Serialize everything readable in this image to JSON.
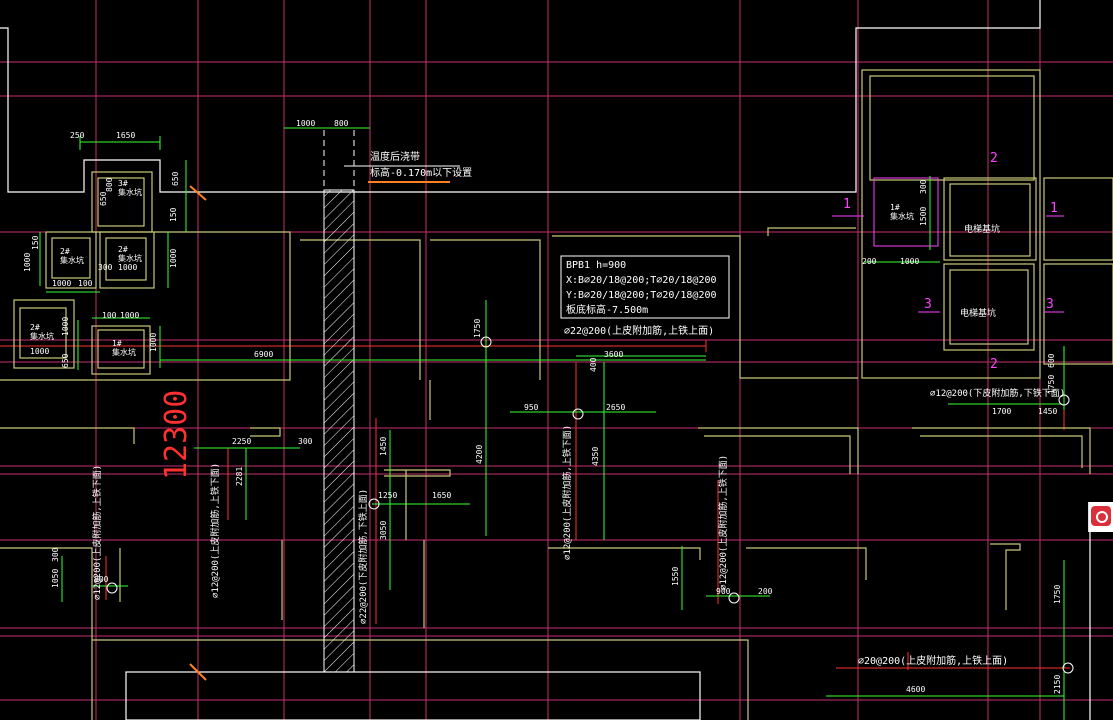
{
  "colors": {
    "background": "#000000",
    "axis": "#d0408c",
    "wall": "#c8c878",
    "rebar_red": "#ff3030",
    "dimension": "#33ff33",
    "outline": "#ffffff",
    "label": "#ffffff",
    "magenta": "#ff40ff",
    "orange": "#ff8020"
  },
  "notes": {
    "steel_title": "温度后浇带",
    "steel_level": "标高-0.170m以下设置",
    "big_dim": "12300"
  },
  "bpb": {
    "title": "BPB1 h=900",
    "xb": "X:B⌀20/18@200;T⌀20/18@200",
    "yb": "Y:B⌀20/18@200;T⌀20/18@200",
    "level": "板底标高-7.500m"
  },
  "pits": {
    "p1": "1#\n集水坑",
    "p2": "2#\n集水坑",
    "p3": "2#\n集水坑",
    "p4": "3#\n集水坑",
    "p5": "2#\n集水坑",
    "p6": "1#\n集水坑",
    "elevator1": "电梯基坑",
    "elevator2": "电梯基坑"
  },
  "rebar": {
    "r1": "⌀22@200(上皮附加筋,上铁上面)",
    "r2": "⌀12@200(下皮附加筋,下铁下面)",
    "r3": "⌀20@200(上皮附加筋,上铁上面)",
    "v1": "⌀12@200(上皮附加筋,上铁下面)",
    "v2": "⌀12@200(上皮附加筋,上铁下面)",
    "v3": "⌀12@200(上皮附加筋,上铁下面)",
    "v4": "⌀12@200(上皮附加筋,上铁下面)",
    "v5": "⌀22@200(下皮附加筋,下铁上面)"
  },
  "dims": {
    "d250": "250",
    "d1650a": "1650",
    "d1000a": "1000",
    "d800a": "800",
    "d650a": "650",
    "d650b": "650",
    "d100a": "100",
    "d150": "150",
    "d1000b": "1000",
    "d1000c": "1000",
    "d1000d": "1000",
    "d300": "300",
    "d1000e": "1000",
    "d1000f": "1000",
    "d100b": "100",
    "d1000g": "1000",
    "d6900": "6900",
    "d1750a": "1750",
    "d3600": "3600",
    "d400": "400",
    "d950": "950",
    "d2650": "2650",
    "d2250": "2250",
    "d300b": "300",
    "d1450": "1450",
    "d4200": "4200",
    "d4350": "4350",
    "d1250": "1250",
    "d1650b": "1650",
    "d3050": "3050",
    "d2281": "2281",
    "d1550": "1550",
    "d900": "900",
    "d200": "200",
    "d800b": "800",
    "d1050": "1050",
    "d300c": "300",
    "d200b": "200",
    "d1000h": "1000",
    "d1500": "1500",
    "d1700": "1700",
    "d1450b": "1450",
    "d600": "600",
    "d1750b": "1750",
    "d1750c": "1750",
    "d4600": "4600",
    "d2150": "2150"
  },
  "axis_marks": {
    "m1": "1",
    "m1b": "1",
    "m2": "2",
    "m2b": "2",
    "m3": "3",
    "m3b": "3"
  }
}
